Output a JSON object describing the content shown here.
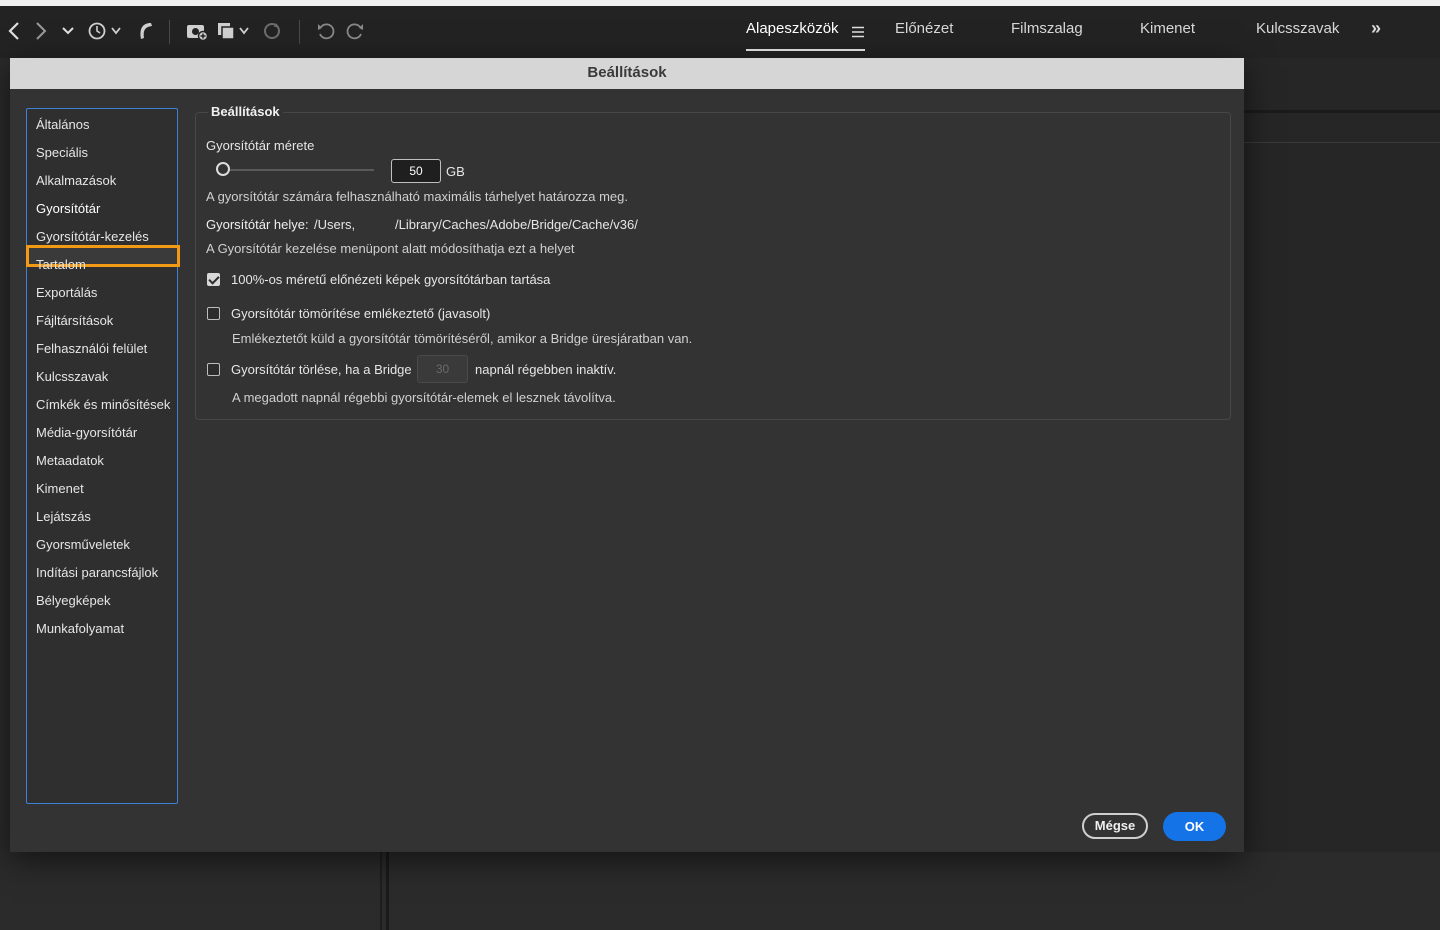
{
  "toolbar": {
    "icons": [
      "back-arrow-icon",
      "forward-arrow-icon",
      "chevron-down-icon",
      "recent-history-icon",
      "boomerang-icon",
      "camera-import-icon",
      "copy-stack-icon",
      "refresh-icon",
      "rotate-left-icon",
      "rotate-right-icon"
    ],
    "workspaces": [
      {
        "label": "Alapeszközök",
        "active": true
      },
      {
        "label": "Előnézet",
        "active": false
      },
      {
        "label": "Filmszalag",
        "active": false
      },
      {
        "label": "Kimenet",
        "active": false
      },
      {
        "label": "Kulcsszavak",
        "active": false
      }
    ],
    "overflow_label": "»",
    "menu_icon": "hamburger-icon"
  },
  "dialog": {
    "title": "Beállítások",
    "categories": [
      "Általános",
      "Speciális",
      "Alkalmazások",
      "Gyorsítótár",
      "Gyorsítótár-kezelés",
      "Tartalom",
      "Exportálás",
      "Fájltársítások",
      "Felhasználói felület",
      "Kulcsszavak",
      "Címkék és minősítések",
      "Média-gyorsítótár",
      "Metaadatok",
      "Kimenet",
      "Lejátszás",
      "Gyorsműveletek",
      "Indítási parancsfájlok",
      "Bélyegképek",
      "Munkafolyamat"
    ],
    "selected_category": "Gyorsítótár",
    "group_title": "Beállítások",
    "cache_size": {
      "label": "Gyorsítótár mérete",
      "value": "50",
      "unit": "GB",
      "description": "A gyorsítótár számára felhasználható maximális tárhelyet határozza meg."
    },
    "cache_location": {
      "label": "Gyorsítótár helye:",
      "path_start": "/Users,",
      "path_end": "/Library/Caches/Adobe/Bridge/Cache/v36/",
      "description": "A Gyorsítótár kezelése menüpont alatt módosíthatja ezt a helyet"
    },
    "options": [
      {
        "label": "100%-os méretű előnézeti képek gyorsítótárban tartása",
        "checked": true
      },
      {
        "label": "Gyorsítótár tömörítése emlékeztető (javasolt)",
        "checked": false,
        "description": "Emlékeztetőt küld a gyorsítótár tömörítéséről, amikor a Bridge üresjáratban van."
      },
      {
        "label": "Gyorsítótár törlése, ha a Bridge",
        "checked": false,
        "days_value": "30",
        "suffix": "napnál régebben inaktív.",
        "description": "A megadott napnál régebbi gyorsítótár-elemek el lesznek távolítva."
      }
    ],
    "cancel_label": "Mégse",
    "ok_label": "OK"
  },
  "colors": {
    "accent": "#1473e6",
    "highlight": "#f29a16",
    "list_border": "#3f7fd6"
  }
}
